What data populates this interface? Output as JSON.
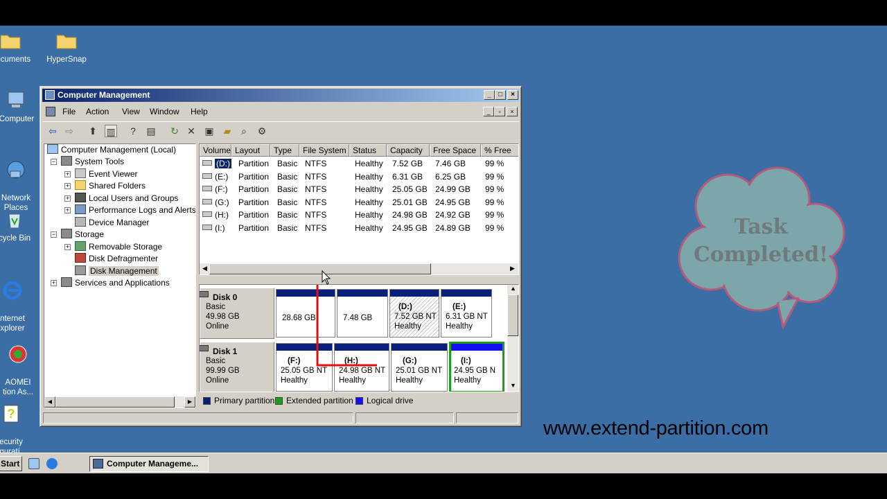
{
  "desktop": {
    "icons": [
      {
        "label": "Documents"
      },
      {
        "label": "HyperSnap"
      },
      {
        "label": "Computer"
      },
      {
        "label": "Network\nPlaces"
      },
      {
        "label": "cycle Bin"
      },
      {
        "label": "nternet\nxplorer"
      },
      {
        "label": "AOMEI\ntion As..."
      },
      {
        "label": "ecurity\nfiguratí..."
      }
    ],
    "cloud_text": "Task\nCompleted!",
    "site_url": "www.extend-partition.com"
  },
  "taskbar": {
    "start_label": "Start",
    "task_item": "Computer Manageme..."
  },
  "window": {
    "title": "Computer Management",
    "menu": [
      "File",
      "Action",
      "View",
      "Window",
      "Help"
    ],
    "tree": [
      {
        "label": "Computer Management (Local)"
      },
      {
        "label": "System Tools"
      },
      {
        "label": "Event Viewer"
      },
      {
        "label": "Shared Folders"
      },
      {
        "label": "Local Users and Groups"
      },
      {
        "label": "Performance Logs and Alerts"
      },
      {
        "label": "Device Manager"
      },
      {
        "label": "Storage"
      },
      {
        "label": "Removable Storage"
      },
      {
        "label": "Disk Defragmenter"
      },
      {
        "label": "Disk Management"
      },
      {
        "label": "Services and Applications"
      }
    ],
    "columns": [
      "Volume",
      "Layout",
      "Type",
      "File System",
      "Status",
      "Capacity",
      "Free Space",
      "% Free"
    ],
    "volumes": [
      {
        "volume": "(D:)",
        "layout": "Partition",
        "type": "Basic",
        "fs": "NTFS",
        "status": "Healthy",
        "capacity": "7.52 GB",
        "free": "7.46 GB",
        "pct": "99 %"
      },
      {
        "volume": "(E:)",
        "layout": "Partition",
        "type": "Basic",
        "fs": "NTFS",
        "status": "Healthy",
        "capacity": "6.31 GB",
        "free": "6.25 GB",
        "pct": "99 %"
      },
      {
        "volume": "(F:)",
        "layout": "Partition",
        "type": "Basic",
        "fs": "NTFS",
        "status": "Healthy",
        "capacity": "25.05 GB",
        "free": "24.99 GB",
        "pct": "99 %"
      },
      {
        "volume": "(G:)",
        "layout": "Partition",
        "type": "Basic",
        "fs": "NTFS",
        "status": "Healthy",
        "capacity": "25.01 GB",
        "free": "24.95 GB",
        "pct": "99 %"
      },
      {
        "volume": "(H:)",
        "layout": "Partition",
        "type": "Basic",
        "fs": "NTFS",
        "status": "Healthy",
        "capacity": "24.98 GB",
        "free": "24.92 GB",
        "pct": "99 %"
      },
      {
        "volume": "(I:)",
        "layout": "Partition",
        "type": "Basic",
        "fs": "NTFS",
        "status": "Healthy",
        "capacity": "24.95 GB",
        "free": "24.89 GB",
        "pct": "99 %"
      }
    ],
    "disks": [
      {
        "name": "Disk 0",
        "type": "Basic",
        "size": "49.98 GB",
        "state": "Online",
        "parts": [
          {
            "label": "",
            "size": "28.68 GB",
            "status": ""
          },
          {
            "label": "",
            "size": "7.48 GB",
            "status": ""
          },
          {
            "label": "(D:)",
            "size": "7.52 GB NT",
            "status": "Healthy"
          },
          {
            "label": "(E:)",
            "size": "6.31 GB NT",
            "status": "Healthy"
          }
        ]
      },
      {
        "name": "Disk 1",
        "type": "Basic",
        "size": "99.99 GB",
        "state": "Online",
        "parts": [
          {
            "label": "(F:)",
            "size": "25.05 GB NT",
            "status": "Healthy"
          },
          {
            "label": "(H:)",
            "size": "24.98 GB NT",
            "status": "Healthy"
          },
          {
            "label": "(G:)",
            "size": "25.01 GB NT",
            "status": "Healthy"
          },
          {
            "label": "(I:)",
            "size": "24.95 GB N",
            "status": "Healthy"
          }
        ]
      }
    ],
    "legend": [
      "Primary partition",
      "Extended partition",
      "Logical drive"
    ]
  },
  "colors": {
    "desktop": "#3a6ea5",
    "primary": "#0a1f7a",
    "extended": "#1e9c1e",
    "logical": "#1010f0",
    "annotation": "#e01010"
  }
}
